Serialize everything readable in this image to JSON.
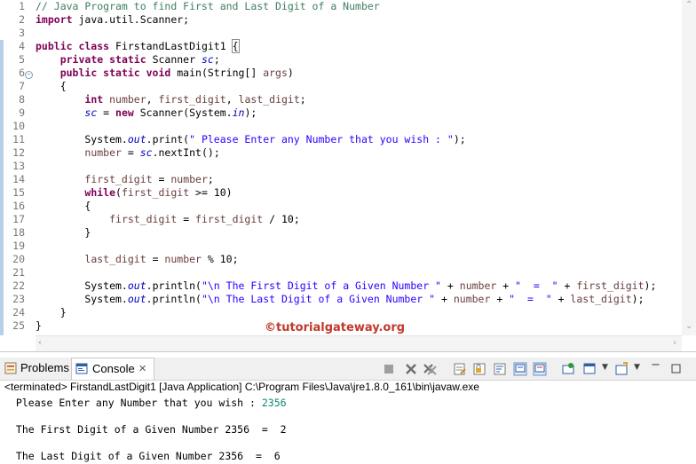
{
  "editor": {
    "line_numbers": [
      "1",
      "2",
      "3",
      "4",
      "5",
      "6",
      "7",
      "8",
      "9",
      "10",
      "11",
      "12",
      "13",
      "14",
      "15",
      "16",
      "17",
      "18",
      "19",
      "20",
      "21",
      "22",
      "23",
      "24",
      "25"
    ],
    "lines": [
      [
        {
          "t": "cm",
          "v": "// Java Program to find First and Last Digit of a Number"
        }
      ],
      [
        {
          "t": "kw",
          "v": "import"
        },
        {
          "t": "",
          "v": " java.util.Scanner;"
        }
      ],
      [],
      [
        {
          "t": "kw",
          "v": "public class"
        },
        {
          "t": "",
          "v": " FirstandLastDigit1 "
        },
        {
          "t": "brk",
          "v": "{"
        }
      ],
      [
        {
          "t": "",
          "v": "    "
        },
        {
          "t": "kw",
          "v": "private static"
        },
        {
          "t": "",
          "v": " Scanner "
        },
        {
          "t": "fld",
          "v": "sc"
        },
        {
          "t": "",
          "v": ";"
        }
      ],
      [
        {
          "t": "",
          "v": "    "
        },
        {
          "t": "kw",
          "v": "public static void"
        },
        {
          "t": "",
          "v": " main(String[] "
        },
        {
          "t": "var",
          "v": "args"
        },
        {
          "t": "",
          "v": ")"
        }
      ],
      [
        {
          "t": "",
          "v": "    {"
        }
      ],
      [
        {
          "t": "",
          "v": "        "
        },
        {
          "t": "kw",
          "v": "int"
        },
        {
          "t": "",
          "v": " "
        },
        {
          "t": "var",
          "v": "number"
        },
        {
          "t": "",
          "v": ", "
        },
        {
          "t": "var",
          "v": "first_digit"
        },
        {
          "t": "",
          "v": ", "
        },
        {
          "t": "var",
          "v": "last_digit"
        },
        {
          "t": "",
          "v": ";"
        }
      ],
      [
        {
          "t": "",
          "v": "        "
        },
        {
          "t": "fld",
          "v": "sc"
        },
        {
          "t": "",
          "v": " = "
        },
        {
          "t": "kw",
          "v": "new"
        },
        {
          "t": "",
          "v": " Scanner(System."
        },
        {
          "t": "fld",
          "v": "in"
        },
        {
          "t": "",
          "v": ");"
        }
      ],
      [],
      [
        {
          "t": "",
          "v": "        System."
        },
        {
          "t": "fld",
          "v": "out"
        },
        {
          "t": "",
          "v": ".print("
        },
        {
          "t": "st",
          "v": "\" Please Enter any Number that you wish : \""
        },
        {
          "t": "",
          "v": ");"
        }
      ],
      [
        {
          "t": "",
          "v": "        "
        },
        {
          "t": "var",
          "v": "number"
        },
        {
          "t": "",
          "v": " = "
        },
        {
          "t": "fld",
          "v": "sc"
        },
        {
          "t": "",
          "v": ".nextInt();"
        }
      ],
      [],
      [
        {
          "t": "",
          "v": "        "
        },
        {
          "t": "var",
          "v": "first_digit"
        },
        {
          "t": "",
          "v": " = "
        },
        {
          "t": "var",
          "v": "number"
        },
        {
          "t": "",
          "v": ";"
        }
      ],
      [
        {
          "t": "",
          "v": "        "
        },
        {
          "t": "kw",
          "v": "while"
        },
        {
          "t": "",
          "v": "("
        },
        {
          "t": "var",
          "v": "first_digit"
        },
        {
          "t": "",
          "v": " >= 10)"
        }
      ],
      [
        {
          "t": "",
          "v": "        {"
        }
      ],
      [
        {
          "t": "",
          "v": "            "
        },
        {
          "t": "var",
          "v": "first_digit"
        },
        {
          "t": "",
          "v": " = "
        },
        {
          "t": "var",
          "v": "first_digit"
        },
        {
          "t": "",
          "v": " / 10;"
        }
      ],
      [
        {
          "t": "",
          "v": "        }"
        }
      ],
      [],
      [
        {
          "t": "",
          "v": "        "
        },
        {
          "t": "var",
          "v": "last_digit"
        },
        {
          "t": "",
          "v": " = "
        },
        {
          "t": "var",
          "v": "number"
        },
        {
          "t": "",
          "v": " % 10;"
        }
      ],
      [],
      [
        {
          "t": "",
          "v": "        System."
        },
        {
          "t": "fld",
          "v": "out"
        },
        {
          "t": "",
          "v": ".println("
        },
        {
          "t": "st",
          "v": "\"\\n The First Digit of a Given Number \""
        },
        {
          "t": "",
          "v": " + "
        },
        {
          "t": "var",
          "v": "number"
        },
        {
          "t": "",
          "v": " + "
        },
        {
          "t": "st",
          "v": "\"  =  \""
        },
        {
          "t": "",
          "v": " + "
        },
        {
          "t": "var",
          "v": "first_digit"
        },
        {
          "t": "",
          "v": ");"
        }
      ],
      [
        {
          "t": "",
          "v": "        System."
        },
        {
          "t": "fld",
          "v": "out"
        },
        {
          "t": "",
          "v": ".println("
        },
        {
          "t": "st",
          "v": "\"\\n The Last Digit of a Given Number \""
        },
        {
          "t": "",
          "v": " + "
        },
        {
          "t": "var",
          "v": "number"
        },
        {
          "t": "",
          "v": " + "
        },
        {
          "t": "st",
          "v": "\"  =  \""
        },
        {
          "t": "",
          "v": " + "
        },
        {
          "t": "var",
          "v": "last_digit"
        },
        {
          "t": "",
          "v": ");"
        }
      ],
      [
        {
          "t": "",
          "v": "    }"
        }
      ],
      [
        {
          "t": "",
          "v": "}"
        }
      ]
    ],
    "fold_marker": "−",
    "watermark": "©tutorialgateway.org"
  },
  "views": {
    "problems_label": "Problems",
    "console_label": "Console",
    "close_glyph": "✕"
  },
  "console": {
    "status": "<terminated> FirstandLastDigit1 [Java Application] C:\\Program Files\\Java\\jre1.8.0_161\\bin\\javaw.exe",
    "prompt": " Please Enter any Number that you wish : ",
    "input": "2356",
    "output_first": " The First Digit of a Given Number 2356  =  2",
    "output_last": " The Last Digit of a Given Number 2356  =  6"
  },
  "colors": {
    "keyword": "#7f0055",
    "comment": "#3f7f5f",
    "string": "#2a00ff",
    "field": "#0000c0",
    "variable": "#6a3e3e",
    "console_input": "#0a8575",
    "watermark": "#c0392b"
  }
}
